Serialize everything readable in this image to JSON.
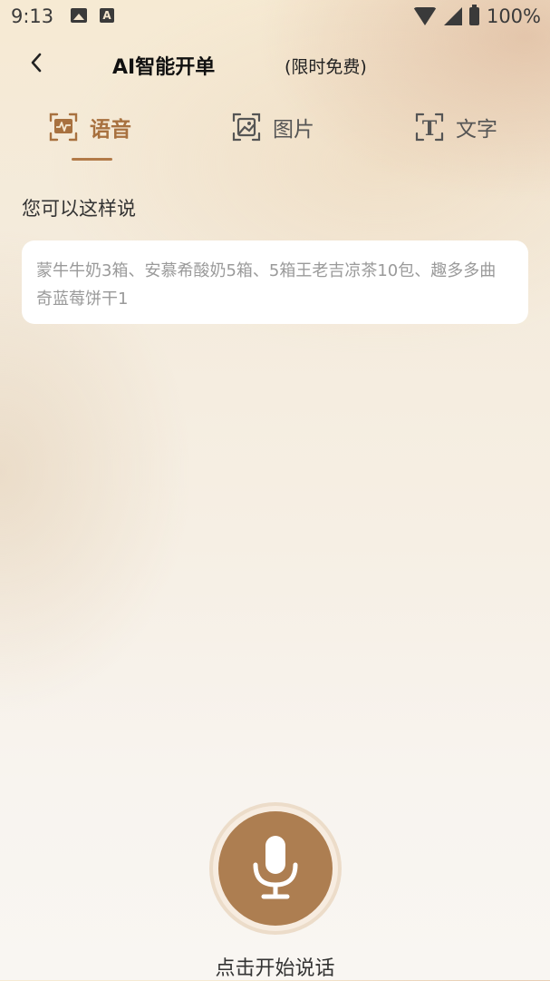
{
  "status_bar": {
    "time": "9:13",
    "battery": "100%",
    "icons": [
      "image-notification-icon",
      "a-notification-icon",
      "wifi-icon",
      "signal-icon",
      "battery-charging-icon"
    ]
  },
  "nav": {
    "back_icon": "chevron-left-icon",
    "title": "AI智能开单",
    "subtitle": "(限时免费)"
  },
  "tabs": [
    {
      "label": "语音",
      "icon": "voice-scan-icon",
      "active": true
    },
    {
      "label": "图片",
      "icon": "image-scan-icon",
      "active": false
    },
    {
      "label": "文字",
      "icon": "text-scan-icon",
      "active": false
    }
  ],
  "hint": {
    "title": "您可以这样说",
    "example": "蒙牛牛奶3箱、安慕希酸奶5箱、5箱王老吉凉茶10包、趣多多曲奇蓝莓饼干1"
  },
  "mic": {
    "icon": "microphone-icon",
    "label": "点击开始说话"
  },
  "colors": {
    "accent": "#a8713f",
    "mic_button": "#ad7e51",
    "card": "#ffffff"
  }
}
